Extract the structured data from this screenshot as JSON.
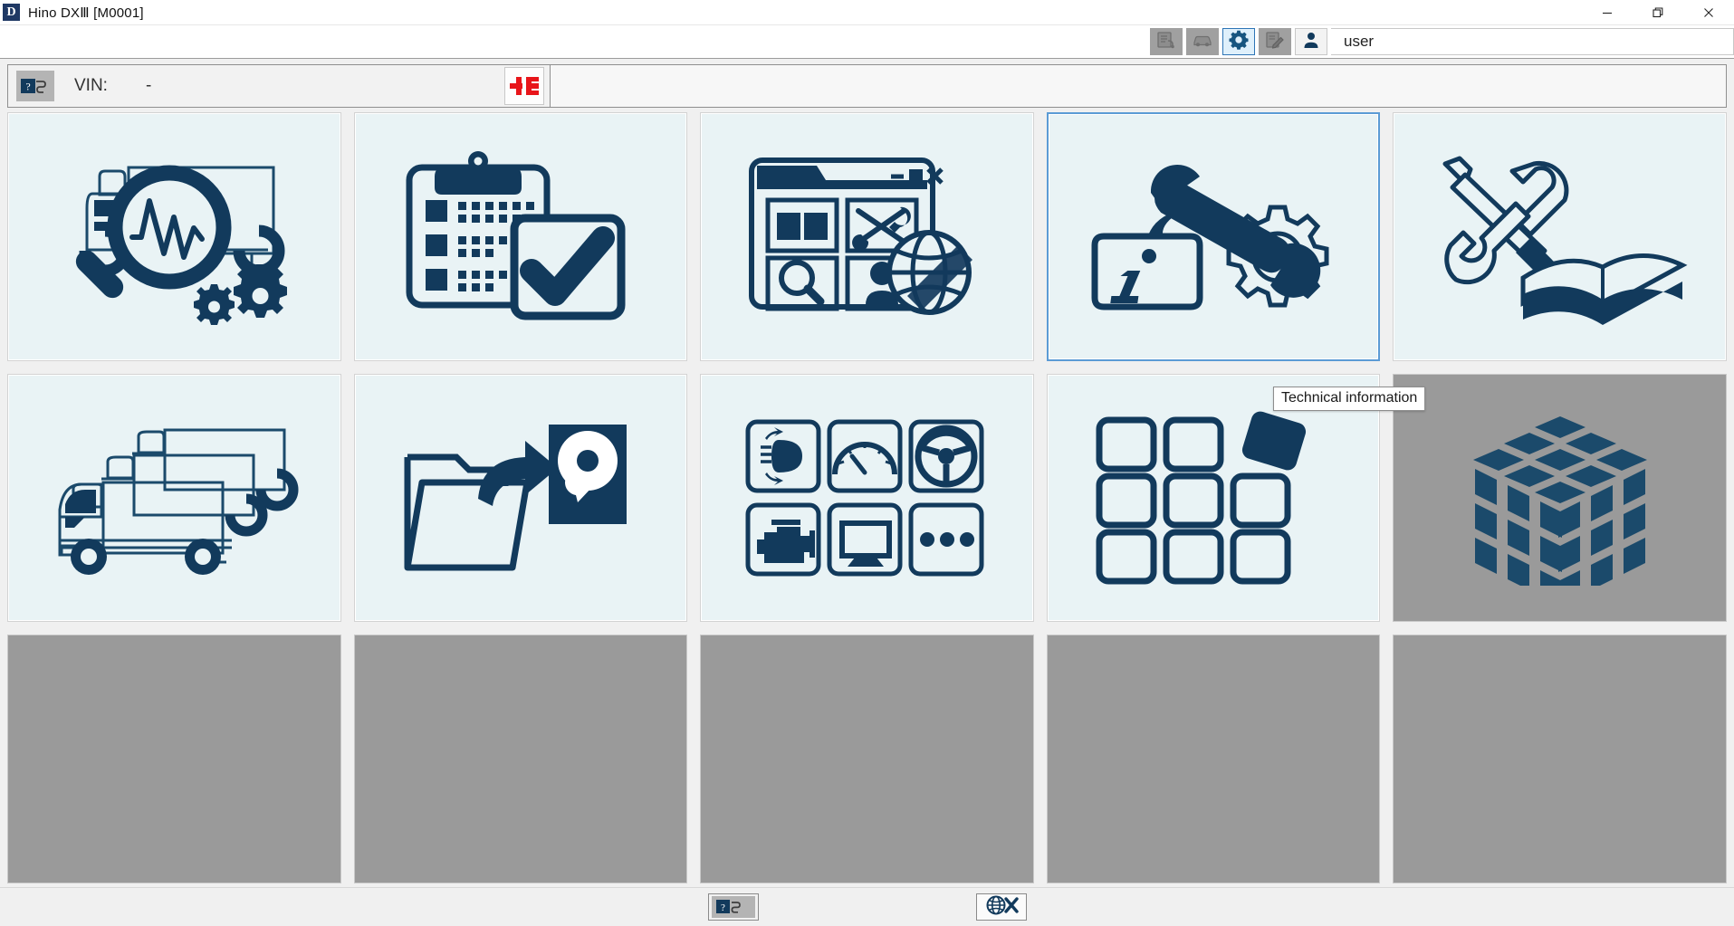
{
  "window": {
    "app_icon": "app-d-icon",
    "title": "Hino DXⅢ [M0001]",
    "controls": {
      "minimize": "minimize-icon",
      "restore": "restore-icon",
      "close": "close-icon"
    }
  },
  "toolbar": {
    "buttons": [
      {
        "name": "vehicle-data-button",
        "icon": "document-card-icon",
        "state": "disabled"
      },
      {
        "name": "vehicle-button",
        "icon": "car-icon",
        "state": "disabled"
      },
      {
        "name": "settings-button",
        "icon": "gear-icon",
        "state": "active"
      },
      {
        "name": "edit-notes-button",
        "icon": "pen-edit-icon",
        "state": "disabled"
      },
      {
        "name": "user-button",
        "icon": "person-icon",
        "state": "enabled"
      }
    ],
    "user_label": "user"
  },
  "vin_bar": {
    "id_icon": "question-s-icon",
    "label": "VIN:",
    "value": "-",
    "connection_icon": "disconnected-plug-icon",
    "connection_state": "disconnected"
  },
  "tiles": [
    {
      "name": "tile-diagnostics",
      "icon": "truck-magnifier-waveform-gears-icon",
      "state": "enabled"
    },
    {
      "name": "tile-inspection-checklist",
      "icon": "clipboard-checkmark-icon",
      "state": "enabled"
    },
    {
      "name": "tile-online-services",
      "icon": "browser-window-globe-icon",
      "state": "enabled"
    },
    {
      "name": "tile-technical-information",
      "icon": "info-wrench-gear-icon",
      "state": "selected",
      "tooltip": "Technical information"
    },
    {
      "name": "tile-service-manual",
      "icon": "tools-open-book-icon",
      "state": "enabled"
    },
    {
      "name": "tile-vehicle-selection",
      "icon": "three-trucks-icon",
      "state": "enabled"
    },
    {
      "name": "tile-data-transfer",
      "icon": "folder-arrow-harddisk-icon",
      "state": "enabled"
    },
    {
      "name": "tile-ecu-systems",
      "icon": "six-system-icons-grid-icon",
      "state": "enabled"
    },
    {
      "name": "tile-applications",
      "icon": "nine-tile-grid-detached-icon",
      "state": "enabled"
    },
    {
      "name": "tile-database-cube",
      "icon": "isometric-cube-icon",
      "state": "disabled"
    },
    {
      "name": "tile-empty-1",
      "icon": "",
      "state": "empty"
    },
    {
      "name": "tile-empty-2",
      "icon": "",
      "state": "empty"
    },
    {
      "name": "tile-empty-3",
      "icon": "",
      "state": "empty"
    },
    {
      "name": "tile-empty-4",
      "icon": "",
      "state": "empty"
    },
    {
      "name": "tile-empty-5",
      "icon": "",
      "state": "empty"
    }
  ],
  "tooltip": {
    "text": "Technical information"
  },
  "footer": {
    "buttons": [
      {
        "name": "vin-identify-button",
        "icon": "question-s-icon"
      },
      {
        "name": "disconnect-button",
        "icon": "globe-x-icon"
      }
    ]
  },
  "colors": {
    "brand_dark_blue": "#123a5c",
    "tile_background": "#e9f3f5",
    "selected_border": "#5b9bd5",
    "disabled_gray": "#9a9a9a",
    "toolbar_gray": "#a0a0a0",
    "accent_red": "#e8151a",
    "window_background": "#f0f0f0"
  }
}
